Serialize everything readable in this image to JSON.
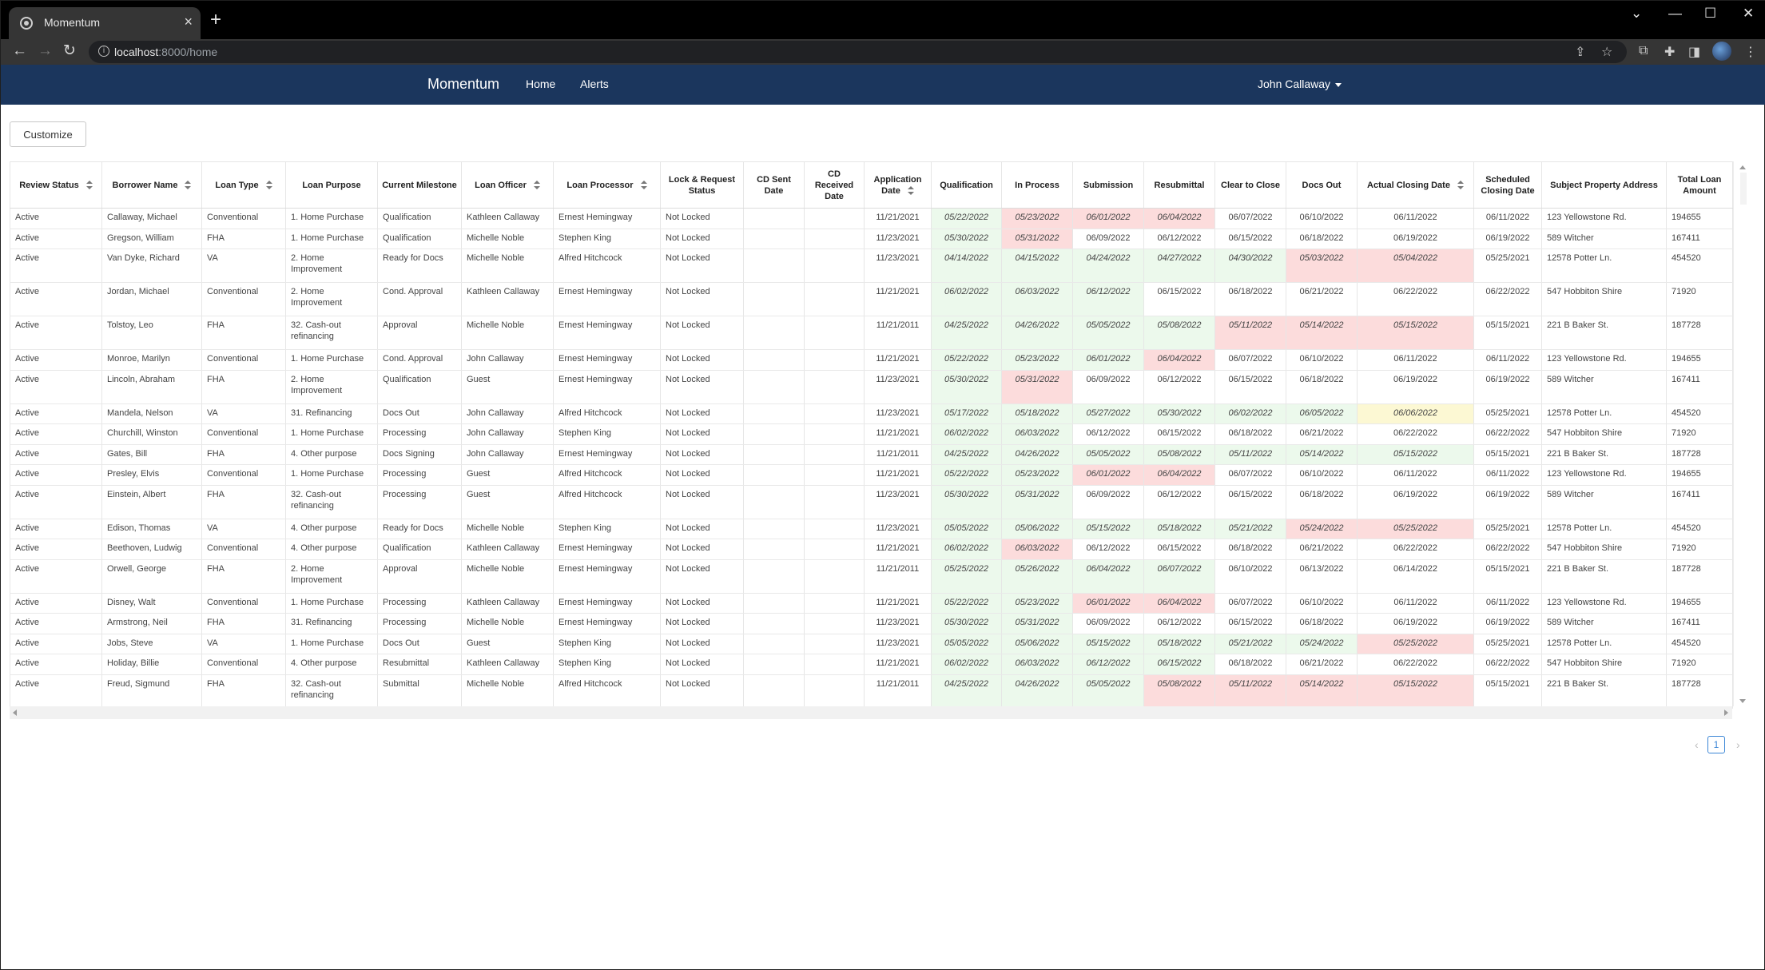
{
  "browser": {
    "tab_title": "Momentum",
    "close_tab": "×",
    "new_tab": "+",
    "url_host": "localhost",
    "url_rest": ":8000/home",
    "info_icon": "i",
    "window_controls": {
      "minimize": "—",
      "maximize": "☐",
      "close": "✕",
      "tab_search": "⌄"
    },
    "nav": {
      "back": "←",
      "forward": "→",
      "reload": "↻"
    },
    "omnibox_actions": {
      "share": "⇪",
      "bookmark": "☆"
    },
    "toolbar_icons": {
      "extension": "⧉",
      "puzzle": "✚",
      "sidebar": "◨",
      "menu": "⋮"
    }
  },
  "app": {
    "brand": "Momentum",
    "nav": {
      "home": "Home",
      "alerts": "Alerts"
    },
    "user": "John Callaway",
    "customize_label": "Customize"
  },
  "table": {
    "columns": [
      "Review Status",
      "Borrower Name",
      "Loan Type",
      "Loan Purpose",
      "Current Milestone",
      "Loan Officer",
      "Loan Processor",
      "Lock & Request Status",
      "CD Sent Date",
      "CD Received Date",
      "Application Date",
      "Qualification",
      "In Process",
      "Submission",
      "Resubmittal",
      "Clear to Close",
      "Docs Out",
      "Actual Closing Date",
      "Scheduled Closing Date",
      "Subject Property Address",
      "Total Loan Amount"
    ],
    "rows": [
      {
        "review": "Active",
        "borrower": "Callaway, Michael",
        "type": "Conventional",
        "purpose": "1. Home Purchase",
        "milestone": "Qualification",
        "officer": "Kathleen Callaway",
        "processor": "Ernest Hemingway",
        "lock": "Not Locked",
        "cd_sent": "",
        "cd_received": "",
        "app_date": "11/21/2021",
        "qual": "05/22/2022",
        "inproc": "05/23/2022",
        "sub": "06/01/2022",
        "resub": "06/04/2022",
        "ctc": "06/07/2022",
        "docs": "06/10/2022",
        "actual": "06/11/2022",
        "sched": "06/11/2022",
        "address": "123 Yellowstone Rd.",
        "amount": "194655"
      },
      {
        "review": "Active",
        "borrower": "Gregson, William",
        "type": "FHA",
        "purpose": "1. Home Purchase",
        "milestone": "Qualification",
        "officer": "Michelle Noble",
        "processor": "Stephen King",
        "lock": "Not Locked",
        "cd_sent": "",
        "cd_received": "",
        "app_date": "11/23/2021",
        "qual": "05/30/2022",
        "inproc": "05/31/2022",
        "sub": "06/09/2022",
        "resub": "06/12/2022",
        "ctc": "06/15/2022",
        "docs": "06/18/2022",
        "actual": "06/19/2022",
        "sched": "06/19/2022",
        "address": "589 Witcher",
        "amount": "167411"
      },
      {
        "review": "Active",
        "borrower": "Van Dyke, Richard",
        "type": "VA",
        "purpose": "2. Home Improvement",
        "milestone": "Ready for Docs",
        "officer": "Michelle Noble",
        "processor": "Alfred Hitchcock",
        "lock": "Not Locked",
        "cd_sent": "",
        "cd_received": "",
        "app_date": "11/23/2021",
        "qual": "04/14/2022",
        "inproc": "04/15/2022",
        "sub": "04/24/2022",
        "resub": "04/27/2022",
        "ctc": "04/30/2022",
        "docs": "05/03/2022",
        "actual": "05/04/2022",
        "sched": "05/25/2021",
        "address": "12578 Potter Ln.",
        "amount": "454520"
      },
      {
        "review": "Active",
        "borrower": "Jordan, Michael",
        "type": "Conventional",
        "purpose": "2. Home Improvement",
        "milestone": "Cond. Approval",
        "officer": "Kathleen Callaway",
        "processor": "Ernest Hemingway",
        "lock": "Not Locked",
        "cd_sent": "",
        "cd_received": "",
        "app_date": "11/21/2021",
        "qual": "06/02/2022",
        "inproc": "06/03/2022",
        "sub": "06/12/2022",
        "resub": "06/15/2022",
        "ctc": "06/18/2022",
        "docs": "06/21/2022",
        "actual": "06/22/2022",
        "sched": "06/22/2022",
        "address": "547 Hobbiton Shire",
        "amount": "71920"
      },
      {
        "review": "Active",
        "borrower": "Tolstoy, Leo",
        "type": "FHA",
        "purpose": "32. Cash-out refinancing",
        "milestone": "Approval",
        "officer": "Michelle Noble",
        "processor": "Ernest Hemingway",
        "lock": "Not Locked",
        "cd_sent": "",
        "cd_received": "",
        "app_date": "11/21/2011",
        "qual": "04/25/2022",
        "inproc": "04/26/2022",
        "sub": "05/05/2022",
        "resub": "05/08/2022",
        "ctc": "05/11/2022",
        "docs": "05/14/2022",
        "actual": "05/15/2022",
        "sched": "05/15/2021",
        "address": "221 B Baker St.",
        "amount": "187728"
      },
      {
        "review": "Active",
        "borrower": "Monroe, Marilyn",
        "type": "Conventional",
        "purpose": "1. Home Purchase",
        "milestone": "Cond. Approval",
        "officer": "John Callaway",
        "processor": "Ernest Hemingway",
        "lock": "Not Locked",
        "cd_sent": "",
        "cd_received": "",
        "app_date": "11/21/2021",
        "qual": "05/22/2022",
        "inproc": "05/23/2022",
        "sub": "06/01/2022",
        "resub": "06/04/2022",
        "ctc": "06/07/2022",
        "docs": "06/10/2022",
        "actual": "06/11/2022",
        "sched": "06/11/2022",
        "address": "123 Yellowstone Rd.",
        "amount": "194655"
      },
      {
        "review": "Active",
        "borrower": "Lincoln, Abraham",
        "type": "FHA",
        "purpose": "2. Home Improvement",
        "milestone": "Qualification",
        "officer": "Guest",
        "processor": "Ernest Hemingway",
        "lock": "Not Locked",
        "cd_sent": "",
        "cd_received": "",
        "app_date": "11/23/2021",
        "qual": "05/30/2022",
        "inproc": "05/31/2022",
        "sub": "06/09/2022",
        "resub": "06/12/2022",
        "ctc": "06/15/2022",
        "docs": "06/18/2022",
        "actual": "06/19/2022",
        "sched": "06/19/2022",
        "address": "589 Witcher",
        "amount": "167411"
      },
      {
        "review": "Active",
        "borrower": "Mandela, Nelson",
        "type": "VA",
        "purpose": "31. Refinancing",
        "milestone": "Docs Out",
        "officer": "John Callaway",
        "processor": "Alfred Hitchcock",
        "lock": "Not Locked",
        "cd_sent": "",
        "cd_received": "",
        "app_date": "11/23/2021",
        "qual": "05/17/2022",
        "inproc": "05/18/2022",
        "sub": "05/27/2022",
        "resub": "05/30/2022",
        "ctc": "06/02/2022",
        "docs": "06/05/2022",
        "actual": "06/06/2022",
        "sched": "05/25/2021",
        "address": "12578 Potter Ln.",
        "amount": "454520"
      },
      {
        "review": "Active",
        "borrower": "Churchill, Winston",
        "type": "Conventional",
        "purpose": "1. Home Purchase",
        "milestone": "Processing",
        "officer": "John Callaway",
        "processor": "Stephen King",
        "lock": "Not Locked",
        "cd_sent": "",
        "cd_received": "",
        "app_date": "11/21/2021",
        "qual": "06/02/2022",
        "inproc": "06/03/2022",
        "sub": "06/12/2022",
        "resub": "06/15/2022",
        "ctc": "06/18/2022",
        "docs": "06/21/2022",
        "actual": "06/22/2022",
        "sched": "06/22/2022",
        "address": "547 Hobbiton Shire",
        "amount": "71920"
      },
      {
        "review": "Active",
        "borrower": "Gates, Bill",
        "type": "FHA",
        "purpose": "4. Other purpose",
        "milestone": "Docs Signing",
        "officer": "John Callaway",
        "processor": "Ernest Hemingway",
        "lock": "Not Locked",
        "cd_sent": "",
        "cd_received": "",
        "app_date": "11/21/2011",
        "qual": "04/25/2022",
        "inproc": "04/26/2022",
        "sub": "05/05/2022",
        "resub": "05/08/2022",
        "ctc": "05/11/2022",
        "docs": "05/14/2022",
        "actual": "05/15/2022",
        "sched": "05/15/2021",
        "address": "221 B Baker St.",
        "amount": "187728"
      },
      {
        "review": "Active",
        "borrower": "Presley, Elvis",
        "type": "Conventional",
        "purpose": "1. Home Purchase",
        "milestone": "Processing",
        "officer": "Guest",
        "processor": "Alfred Hitchcock",
        "lock": "Not Locked",
        "cd_sent": "",
        "cd_received": "",
        "app_date": "11/21/2021",
        "qual": "05/22/2022",
        "inproc": "05/23/2022",
        "sub": "06/01/2022",
        "resub": "06/04/2022",
        "ctc": "06/07/2022",
        "docs": "06/10/2022",
        "actual": "06/11/2022",
        "sched": "06/11/2022",
        "address": "123 Yellowstone Rd.",
        "amount": "194655"
      },
      {
        "review": "Active",
        "borrower": "Einstein, Albert",
        "type": "FHA",
        "purpose": "32. Cash-out refinancing",
        "milestone": "Processing",
        "officer": "Guest",
        "processor": "Alfred Hitchcock",
        "lock": "Not Locked",
        "cd_sent": "",
        "cd_received": "",
        "app_date": "11/23/2021",
        "qual": "05/30/2022",
        "inproc": "05/31/2022",
        "sub": "06/09/2022",
        "resub": "06/12/2022",
        "ctc": "06/15/2022",
        "docs": "06/18/2022",
        "actual": "06/19/2022",
        "sched": "06/19/2022",
        "address": "589 Witcher",
        "amount": "167411"
      },
      {
        "review": "Active",
        "borrower": "Edison, Thomas",
        "type": "VA",
        "purpose": "4. Other purpose",
        "milestone": "Ready for Docs",
        "officer": "Michelle Noble",
        "processor": "Stephen King",
        "lock": "Not Locked",
        "cd_sent": "",
        "cd_received": "",
        "app_date": "11/23/2021",
        "qual": "05/05/2022",
        "inproc": "05/06/2022",
        "sub": "05/15/2022",
        "resub": "05/18/2022",
        "ctc": "05/21/2022",
        "docs": "05/24/2022",
        "actual": "05/25/2022",
        "sched": "05/25/2021",
        "address": "12578 Potter Ln.",
        "amount": "454520"
      },
      {
        "review": "Active",
        "borrower": "Beethoven, Ludwig",
        "type": "Conventional",
        "purpose": "4. Other purpose",
        "milestone": "Qualification",
        "officer": "Kathleen Callaway",
        "processor": "Ernest Hemingway",
        "lock": "Not Locked",
        "cd_sent": "",
        "cd_received": "",
        "app_date": "11/21/2021",
        "qual": "06/02/2022",
        "inproc": "06/03/2022",
        "sub": "06/12/2022",
        "resub": "06/15/2022",
        "ctc": "06/18/2022",
        "docs": "06/21/2022",
        "actual": "06/22/2022",
        "sched": "06/22/2022",
        "address": "547 Hobbiton Shire",
        "amount": "71920"
      },
      {
        "review": "Active",
        "borrower": "Orwell, George",
        "type": "FHA",
        "purpose": "2. Home Improvement",
        "milestone": "Approval",
        "officer": "Michelle Noble",
        "processor": "Ernest Hemingway",
        "lock": "Not Locked",
        "cd_sent": "",
        "cd_received": "",
        "app_date": "11/21/2011",
        "qual": "05/25/2022",
        "inproc": "05/26/2022",
        "sub": "06/04/2022",
        "resub": "06/07/2022",
        "ctc": "06/10/2022",
        "docs": "06/13/2022",
        "actual": "06/14/2022",
        "sched": "05/15/2021",
        "address": "221 B Baker St.",
        "amount": "187728"
      },
      {
        "review": "Active",
        "borrower": "Disney, Walt",
        "type": "Conventional",
        "purpose": "1. Home Purchase",
        "milestone": "Processing",
        "officer": "Kathleen Callaway",
        "processor": "Ernest Hemingway",
        "lock": "Not Locked",
        "cd_sent": "",
        "cd_received": "",
        "app_date": "11/21/2021",
        "qual": "05/22/2022",
        "inproc": "05/23/2022",
        "sub": "06/01/2022",
        "resub": "06/04/2022",
        "ctc": "06/07/2022",
        "docs": "06/10/2022",
        "actual": "06/11/2022",
        "sched": "06/11/2022",
        "address": "123 Yellowstone Rd.",
        "amount": "194655"
      },
      {
        "review": "Active",
        "borrower": "Armstrong, Neil",
        "type": "FHA",
        "purpose": "31. Refinancing",
        "milestone": "Processing",
        "officer": "Michelle Noble",
        "processor": "Ernest Hemingway",
        "lock": "Not Locked",
        "cd_sent": "",
        "cd_received": "",
        "app_date": "11/23/2021",
        "qual": "05/30/2022",
        "inproc": "05/31/2022",
        "sub": "06/09/2022",
        "resub": "06/12/2022",
        "ctc": "06/15/2022",
        "docs": "06/18/2022",
        "actual": "06/19/2022",
        "sched": "06/19/2022",
        "address": "589 Witcher",
        "amount": "167411"
      },
      {
        "review": "Active",
        "borrower": "Jobs, Steve",
        "type": "VA",
        "purpose": "1. Home Purchase",
        "milestone": "Docs Out",
        "officer": "Guest",
        "processor": "Stephen King",
        "lock": "Not Locked",
        "cd_sent": "",
        "cd_received": "",
        "app_date": "11/23/2021",
        "qual": "05/05/2022",
        "inproc": "05/06/2022",
        "sub": "05/15/2022",
        "resub": "05/18/2022",
        "ctc": "05/21/2022",
        "docs": "05/24/2022",
        "actual": "05/25/2022",
        "sched": "05/25/2021",
        "address": "12578 Potter Ln.",
        "amount": "454520"
      },
      {
        "review": "Active",
        "borrower": "Holiday, Billie",
        "type": "Conventional",
        "purpose": "4. Other purpose",
        "milestone": "Resubmittal",
        "officer": "Kathleen Callaway",
        "processor": "Stephen King",
        "lock": "Not Locked",
        "cd_sent": "",
        "cd_received": "",
        "app_date": "11/21/2021",
        "qual": "06/02/2022",
        "inproc": "06/03/2022",
        "sub": "06/12/2022",
        "resub": "06/15/2022",
        "ctc": "06/18/2022",
        "docs": "06/21/2022",
        "actual": "06/22/2022",
        "sched": "06/22/2022",
        "address": "547 Hobbiton Shire",
        "amount": "71920"
      },
      {
        "review": "Active",
        "borrower": "Freud, Sigmund",
        "type": "FHA",
        "purpose": "32. Cash-out refinancing",
        "milestone": "Submittal",
        "officer": "Michelle Noble",
        "processor": "Alfred Hitchcock",
        "lock": "Not Locked",
        "cd_sent": "",
        "cd_received": "",
        "app_date": "11/21/2011",
        "qual": "04/25/2022",
        "inproc": "04/26/2022",
        "sub": "05/05/2022",
        "resub": "05/08/2022",
        "ctc": "05/11/2022",
        "docs": "05/14/2022",
        "actual": "05/15/2022",
        "sched": "05/15/2021",
        "address": "221 B Baker St.",
        "amount": "187728"
      }
    ],
    "milestone_status": [
      [
        "g",
        "r",
        "r",
        "r",
        "n",
        "n",
        "n"
      ],
      [
        "g",
        "r",
        "n",
        "n",
        "n",
        "n",
        "n"
      ],
      [
        "g",
        "g",
        "g",
        "g",
        "g",
        "r",
        "r"
      ],
      [
        "g",
        "g",
        "g",
        "n",
        "n",
        "n",
        "n"
      ],
      [
        "g",
        "g",
        "g",
        "g",
        "r",
        "r",
        "r"
      ],
      [
        "g",
        "g",
        "g",
        "r",
        "n",
        "n",
        "n"
      ],
      [
        "g",
        "r",
        "n",
        "n",
        "n",
        "n",
        "n"
      ],
      [
        "g",
        "g",
        "g",
        "g",
        "g",
        "g",
        "y"
      ],
      [
        "g",
        "g",
        "n",
        "n",
        "n",
        "n",
        "n"
      ],
      [
        "g",
        "g",
        "g",
        "g",
        "g",
        "g",
        "g"
      ],
      [
        "g",
        "g",
        "r",
        "r",
        "n",
        "n",
        "n"
      ],
      [
        "g",
        "g",
        "n",
        "n",
        "n",
        "n",
        "n"
      ],
      [
        "g",
        "g",
        "g",
        "g",
        "g",
        "r",
        "r"
      ],
      [
        "g",
        "r",
        "n",
        "n",
        "n",
        "n",
        "n"
      ],
      [
        "g",
        "g",
        "g",
        "g",
        "n",
        "n",
        "n"
      ],
      [
        "g",
        "g",
        "r",
        "r",
        "n",
        "n",
        "n"
      ],
      [
        "g",
        "g",
        "n",
        "n",
        "n",
        "n",
        "n"
      ],
      [
        "g",
        "g",
        "g",
        "g",
        "g",
        "g",
        "r"
      ],
      [
        "g",
        "g",
        "g",
        "g",
        "n",
        "n",
        "n"
      ],
      [
        "g",
        "g",
        "g",
        "r",
        "r",
        "r",
        "r"
      ]
    ],
    "status_colors": {
      "g": "#ecf9ec",
      "r": "#fcdcdc",
      "y": "#fcf8d3"
    }
  },
  "pagination": {
    "prev": "‹",
    "current": "1",
    "next": "›"
  }
}
